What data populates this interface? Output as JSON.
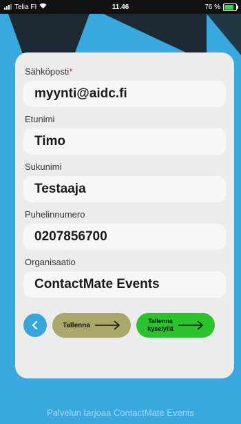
{
  "status_bar": {
    "carrier": "Telia FI",
    "time": "11.46",
    "battery": "76 %",
    "battery_level_percent": 76
  },
  "form": {
    "email": {
      "label": "Sähköposti",
      "required_mark": "*",
      "value": "myynti@aidc.fi"
    },
    "first_name": {
      "label": "Etunimi",
      "value": "Timo"
    },
    "last_name": {
      "label": "Sukunimi",
      "value": "Testaaja"
    },
    "phone": {
      "label": "Puhelinnumero",
      "value": "0207856700"
    },
    "organization": {
      "label": "Organisaatio",
      "value": "ContactMate Events"
    }
  },
  "buttons": {
    "back_icon": "chevron-left-icon",
    "save_label": "Tallenna",
    "save_survey_line1": "Tallenna",
    "save_survey_line2": "kyselyllä",
    "arrow_icon": "arrow-right-icon"
  },
  "footer": {
    "text": "Palvelun tarjoaa ContactMate Events"
  },
  "colors": {
    "background": "#38a8de",
    "card": "#ececec",
    "save_button": "#a9a86a",
    "save_survey_button": "#2bc22b",
    "back_button": "#39a6d9",
    "required": "#e02020"
  }
}
